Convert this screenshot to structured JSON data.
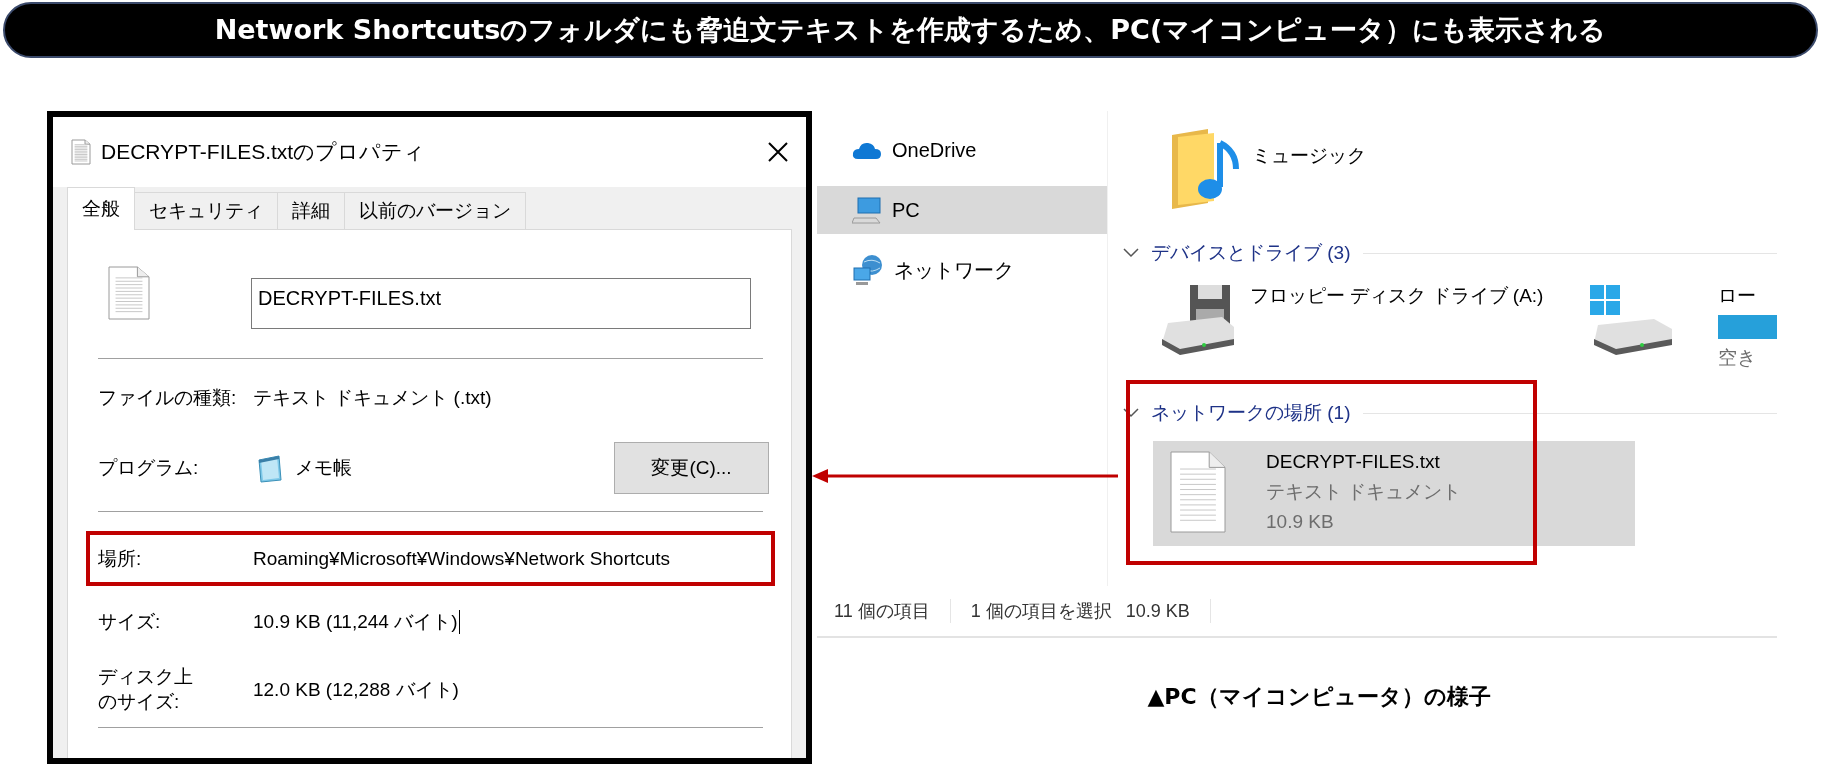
{
  "banner": "Network Shortcutsのフォルダにも脅迫文テキストを作成するため、PC(マイコンピュータ）にも表示される",
  "dialog": {
    "title": "DECRYPT-FILES.txtのプロパティ",
    "tabs": [
      {
        "label": "全般",
        "selected": true
      },
      {
        "label": "セキュリティ",
        "selected": false
      },
      {
        "label": "詳細",
        "selected": false
      },
      {
        "label": "以前のバージョン",
        "selected": false
      }
    ],
    "file_name": "DECRYPT-FILES.txt",
    "rows": [
      {
        "kind": "text",
        "label": "ファイルの種類:",
        "value": "テキスト ドキュメント (.txt)",
        "highlighted": false
      },
      {
        "kind": "program",
        "label": "プログラム:",
        "value": "メモ帳",
        "button": "変更(C)...",
        "highlighted": false
      },
      {
        "kind": "text",
        "label": "場所:",
        "value": "Roaming¥Microsoft¥Windows¥Network Shortcuts",
        "highlighted": true
      },
      {
        "kind": "text",
        "label": "サイズ:",
        "value": "10.9 KB (11,244 バイト)",
        "cursor": true,
        "highlighted": false
      },
      {
        "kind": "wrapped",
        "label": "ディスク上のサイズ:",
        "value": "12.0 KB (12,288 バイト)",
        "highlighted": false
      }
    ]
  },
  "explorer": {
    "nav": [
      {
        "kind": "cloud",
        "label": "OneDrive",
        "selected": false
      },
      {
        "kind": "pc",
        "label": "PC",
        "selected": true
      },
      {
        "kind": "network",
        "label": "ネットワーク",
        "selected": false
      }
    ],
    "top_items": [
      {
        "kind": "music",
        "name": "ミュージック"
      }
    ],
    "groups": [
      {
        "title": "デバイスとドライブ (3)",
        "highlighted": false,
        "items": [
          {
            "kind": "floppy",
            "name": "フロッピー ディスク ドライブ (A:)",
            "selected": false
          },
          {
            "kind": "drive",
            "name": "ロー",
            "level": 1,
            "free": "空き",
            "selected": false
          }
        ]
      },
      {
        "title": "ネットワークの場所 (1)",
        "highlighted": true,
        "items": [
          {
            "kind": "file",
            "name": "DECRYPT-FILES.txt",
            "details": [
              "テキスト ドキュメント",
              "10.9 KB"
            ],
            "selected": true
          }
        ]
      }
    ],
    "status": [
      "11 個の項目",
      "1 個の項目を選択",
      "10.9 KB"
    ]
  },
  "caption": "▲PC（マイコンピュータ）の様子"
}
